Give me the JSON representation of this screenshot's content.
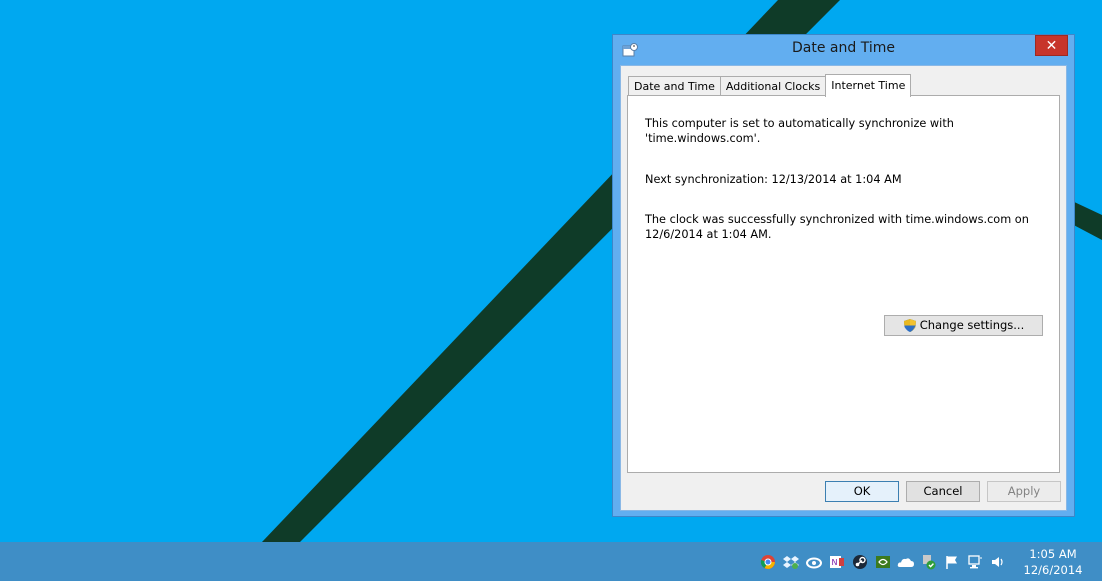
{
  "window": {
    "title": "Date and Time",
    "close_label": "✕",
    "tabs": [
      {
        "label": "Date and Time"
      },
      {
        "label": "Additional Clocks"
      },
      {
        "label": "Internet Time"
      }
    ],
    "active_tab": "Internet Time",
    "panel": {
      "sync_text_line1": "This computer is set to automatically synchronize with",
      "sync_text_line2": "'time.windows.com'.",
      "next_sync": "Next synchronization: 12/13/2014 at 1:04 AM",
      "status_line1": "The clock was successfully synchronized with time.windows.com on",
      "status_line2": "12/6/2014 at 1:04 AM.",
      "change_settings_label": "Change settings..."
    },
    "buttons": {
      "ok": "OK",
      "cancel": "Cancel",
      "apply": "Apply"
    }
  },
  "taskbar": {
    "tray_icons": [
      "chrome-icon",
      "dropbox-icon",
      "creative-cloud-icon",
      "onenote-icon",
      "steam-icon",
      "nvidia-icon",
      "onedrive-icon",
      "antivirus-icon",
      "action-center-flag-icon",
      "network-icon",
      "volume-icon"
    ],
    "clock_time": "1:05 AM",
    "clock_date": "12/6/2014"
  },
  "colors": {
    "desktop": "#00a8f0",
    "taskbar": "#3f8ec6",
    "window_frame": "#62aef0",
    "close_button": "#c7352b"
  }
}
